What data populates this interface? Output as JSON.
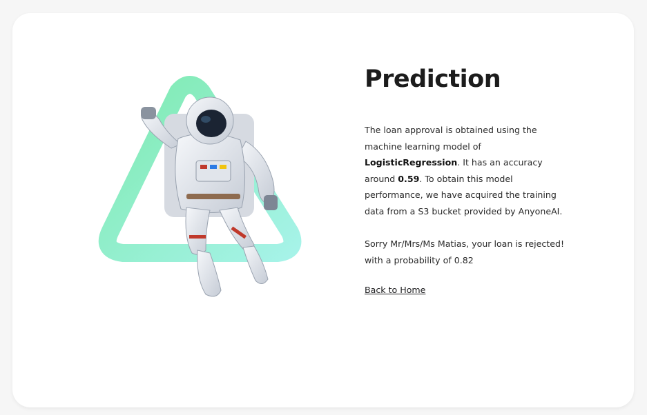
{
  "prediction": {
    "title": "Prediction",
    "description_part1": "The loan approval is obtained using the machine learning model of ",
    "model_name": "LogisticRegression",
    "description_part2": ". It has an accuracy around ",
    "accuracy": "0.59",
    "description_part3": ". To obtain this model performance, we have acquired the training data from a S3 bucket provided by AnyoneAI.",
    "result_line1": "Sorry Mr/Mrs/Ms Matias, your loan is rejected!",
    "result_line2": "with a probability of 0.82",
    "back_link": "Back to Home"
  },
  "illustration": {
    "icon": "astronaut-icon",
    "triangle_gradient": [
      "#6ee7b7",
      "#99f6e4"
    ]
  }
}
